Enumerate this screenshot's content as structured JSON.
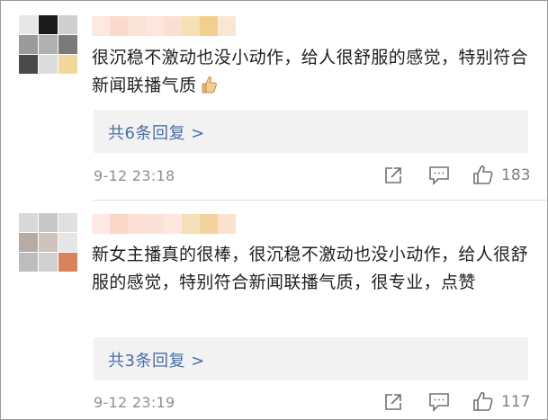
{
  "comments": [
    {
      "text": "很沉稳不激动也没小动作，给人很舒服的感觉，特别符合新闻联播气质",
      "emoji": "thumbs-up-emoji",
      "replies_label": "共6条回复 >",
      "timestamp": "9-12 23:18",
      "like_count": "183",
      "avatar_mosaic": [
        "#e8e8e8",
        "#1a1a1a",
        "#cfcfcf",
        "#9a9a9a",
        "#b0b0b0",
        "#7a7a7a",
        "#4a4a4a",
        "#dcdcdc",
        "#f2d79a"
      ],
      "name_mosaic": [
        "#fde9e2",
        "#fbd9cc",
        "#fce3d8",
        "#fde6dd",
        "#fbdfd2",
        "#f7e0b5",
        "#f3cf8e",
        "#fbe6d4"
      ]
    },
    {
      "text": "新女主播真的很棒，很沉稳不激动也没小动作，给人很舒服的感觉，特别符合新闻联播气质，很专业，点赞",
      "emoji": "",
      "replies_label": "共3条回复 >",
      "timestamp": "9-12 23:19",
      "like_count": "117",
      "avatar_mosaic": [
        "#d9d9d9",
        "#c8c8c8",
        "#e0e0e0",
        "#b8aaa5",
        "#cfc3bd",
        "#e6e6e6",
        "#bdbdbd",
        "#d0d0d0",
        "#d9835c"
      ],
      "name_mosaic": [
        "#fdeae4",
        "#fbd5c6",
        "#fce0d5",
        "#fbe2d8",
        "#fde8e0",
        "#f6deb8",
        "#f4d49e",
        "#fbe3cf"
      ]
    }
  ],
  "icons": {
    "share": "share-icon",
    "comment": "comment-icon",
    "like": "thumbs-up-icon"
  },
  "colors": {
    "link": "#4a6fa5",
    "meta": "#8f8f8f",
    "reply_bg": "#f2f2f2"
  }
}
